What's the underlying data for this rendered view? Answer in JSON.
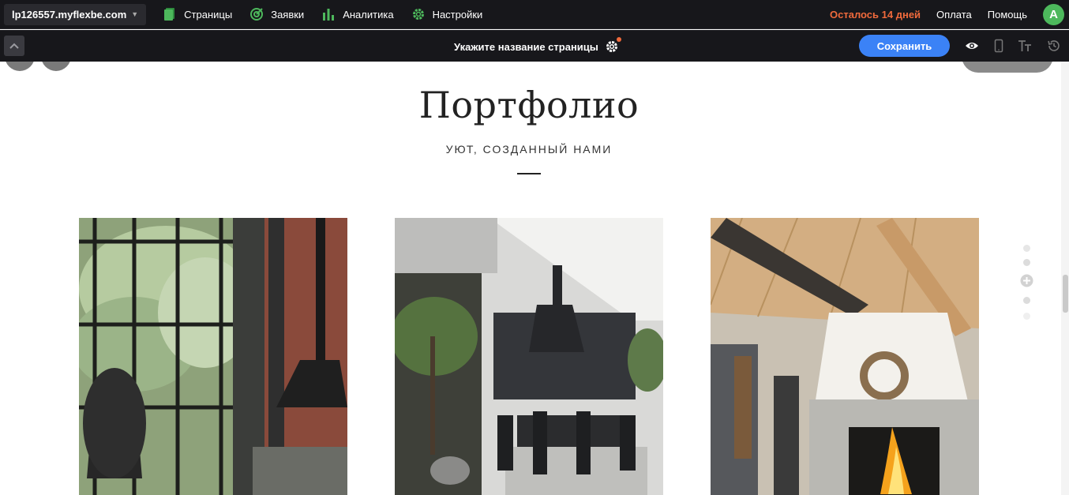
{
  "topbar": {
    "site": "lp126557.myflexbe.com",
    "nav": [
      {
        "label": "Страницы",
        "icon": "pages-icon"
      },
      {
        "label": "Заявки",
        "icon": "requests-icon"
      },
      {
        "label": "Аналитика",
        "icon": "analytics-icon"
      },
      {
        "label": "Настройки",
        "icon": "settings-icon"
      }
    ],
    "trial": "Осталось 14 дней",
    "payment": "Оплата",
    "help": "Помощь",
    "avatar_letter": "A"
  },
  "editbar": {
    "page_name": "Укажите название страницы",
    "save": "Сохранить",
    "tools": [
      "eye-icon",
      "mobile-icon",
      "typography-icon",
      "history-icon"
    ]
  },
  "section": {
    "title": "Портфолио",
    "subtitle": "УЮТ, СОЗДАННЫЙ НАМИ"
  },
  "colors": {
    "accent": "#3b82f6",
    "nav_icon": "#4db85c",
    "trial": "#f06a3c",
    "bar_bg": "#17171b"
  }
}
